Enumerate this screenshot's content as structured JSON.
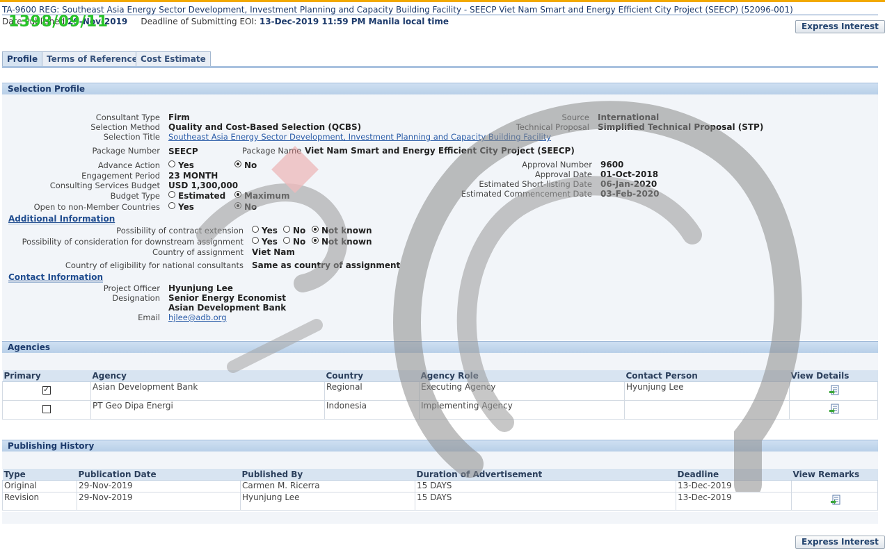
{
  "header": {
    "title": "TA-9600 REG: Southeast Asia Energy Sector Development, Investment Planning and Capacity Building Facility - SEECP Viet Nam Smart and Energy Efficient City Project (SEECP) (52096-001)",
    "date_published_label": "Date Published",
    "date_published": "29-Nov-2019",
    "deadline_label": "Deadline of Submitting EOI:",
    "deadline": "13-Dec-2019 11:59 PM Manila local time",
    "stamp": "1398/09/11"
  },
  "buttons": {
    "express_interest": "Express Interest"
  },
  "tabs": [
    {
      "label": "Profile",
      "active": true
    },
    {
      "label": "Terms of Reference"
    },
    {
      "label": "Cost Estimate"
    }
  ],
  "selection_profile": {
    "heading": "Selection Profile",
    "consultant_type_label": "Consultant Type",
    "consultant_type": "Firm",
    "selection_method_label": "Selection Method",
    "selection_method": "Quality and Cost-Based Selection (QCBS)",
    "selection_title_label": "Selection Title",
    "selection_title": "Southeast Asia Energy Sector Development, Investment Planning and Capacity Building Facility",
    "source_label": "Source",
    "source": "International",
    "technical_proposal_label": "Technical Proposal",
    "technical_proposal": "Simplified Technical Proposal (STP)",
    "package_number_label": "Package Number",
    "package_number": "SEECP",
    "package_name_label": "Package Name",
    "package_name": "Viet Nam Smart and Energy Efficient City Project (SEECP)",
    "advance_action_label": "Advance Action",
    "engagement_period_label": "Engagement Period",
    "engagement_period": "23  MONTH",
    "budget_label": "Consulting Services Budget",
    "budget": "USD 1,300,000",
    "budget_type_label": "Budget Type",
    "open_label": "Open to non-Member Countries",
    "approval_number_label": "Approval Number",
    "approval_number": "9600",
    "approval_date_label": "Approval Date",
    "approval_date": "01-Oct-2018",
    "shortlisting_label": "Estimated Short-listing Date",
    "shortlisting_date": "06-Jan-2020",
    "commencement_label": "Estimated Commencement Date",
    "commencement_date": "03-Feb-2020",
    "opt_yes": "Yes",
    "opt_no": "No",
    "opt_not_known": "Not known",
    "opt_estimated": "Estimated",
    "opt_maximum": "Maximum"
  },
  "additional_information": {
    "heading": "Additional Information",
    "extension_label": "Possibility of contract extension",
    "downstream_label": "Possibility of consideration for downstream assignment",
    "country_label": "Country of assignment",
    "country": "Viet Nam",
    "eligibility_label": "Country of eligibility for national consultants",
    "eligibility": "Same as country of assignment"
  },
  "contact_information": {
    "heading": "Contact Information",
    "officer_label": "Project Officer",
    "officer": "Hyunjung Lee",
    "designation_label": "Designation",
    "designation": "Senior Energy Economist",
    "organization": "Asian Development Bank",
    "email_label": "Email",
    "email": "hjlee@adb.org"
  },
  "agencies": {
    "heading": "Agencies",
    "columns": [
      "Primary",
      "Agency",
      "Country",
      "Agency Role",
      "Contact Person",
      "View Details"
    ],
    "rows": [
      {
        "primary": true,
        "agency": "Asian Development Bank",
        "country": "Regional",
        "role": "Executing Agency",
        "contact": "Hyunjung Lee"
      },
      {
        "primary": false,
        "agency": "PT Geo Dipa Energi",
        "country": "Indonesia",
        "role": "Implementing Agency",
        "contact": ""
      }
    ]
  },
  "publishing_history": {
    "heading": "Publishing History",
    "columns": [
      "Type",
      "Publication Date",
      "Published By",
      "Duration of Advertisement",
      "Deadline",
      "View Remarks"
    ],
    "rows": [
      {
        "type": "Original",
        "date": "29-Nov-2019",
        "by": "Carmen M. Ricerra",
        "duration": "15 DAYS",
        "deadline": "13-Dec-2019"
      },
      {
        "type": "Revision",
        "date": "29-Nov-2019",
        "by": "Hyunjung Lee",
        "duration": "15 DAYS",
        "deadline": "13-Dec-2019"
      }
    ]
  },
  "colors": {
    "accent": "#f2a900",
    "header_band": "#b8cfe8",
    "link": "#2a5ca8",
    "stamp": "#29c429"
  }
}
